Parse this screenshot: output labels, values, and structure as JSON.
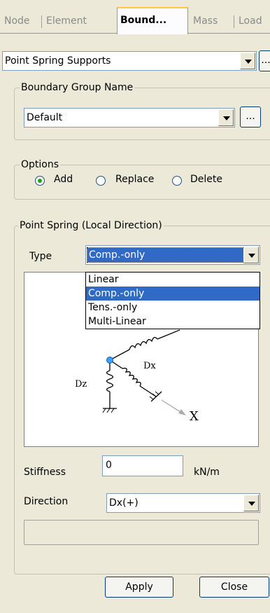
{
  "tabs": [
    {
      "label": "Node"
    },
    {
      "label": "Element"
    },
    {
      "label": "Bound..."
    },
    {
      "label": "Mass"
    },
    {
      "label": "Load"
    }
  ],
  "support_type": {
    "value": "Point Spring Supports",
    "more_label": "..."
  },
  "boundary_group": {
    "legend": "Boundary Group Name",
    "value": "Default",
    "more_label": "..."
  },
  "options": {
    "legend": "Options",
    "items": [
      {
        "label": "Add",
        "checked": true
      },
      {
        "label": "Replace",
        "checked": false
      },
      {
        "label": "Delete",
        "checked": false
      }
    ]
  },
  "point_spring": {
    "legend": "Point Spring (Local Direction)",
    "type_label": "Type",
    "type_value": "Comp.-only",
    "type_options": [
      "Linear",
      "Comp.-only",
      "Tens.-only",
      "Multi-Linear"
    ],
    "highlighted_option": "Comp.-only",
    "diagram": {
      "dx_label": "Dx",
      "dz_label": "Dz",
      "x_label": "X"
    },
    "stiffness_label": "Stiffness",
    "stiffness_value": "0",
    "stiffness_unit": "kN/m",
    "direction_label": "Direction",
    "direction_value": "Dx(+)"
  },
  "footer": {
    "apply_label": "Apply",
    "close_label": "Close"
  }
}
